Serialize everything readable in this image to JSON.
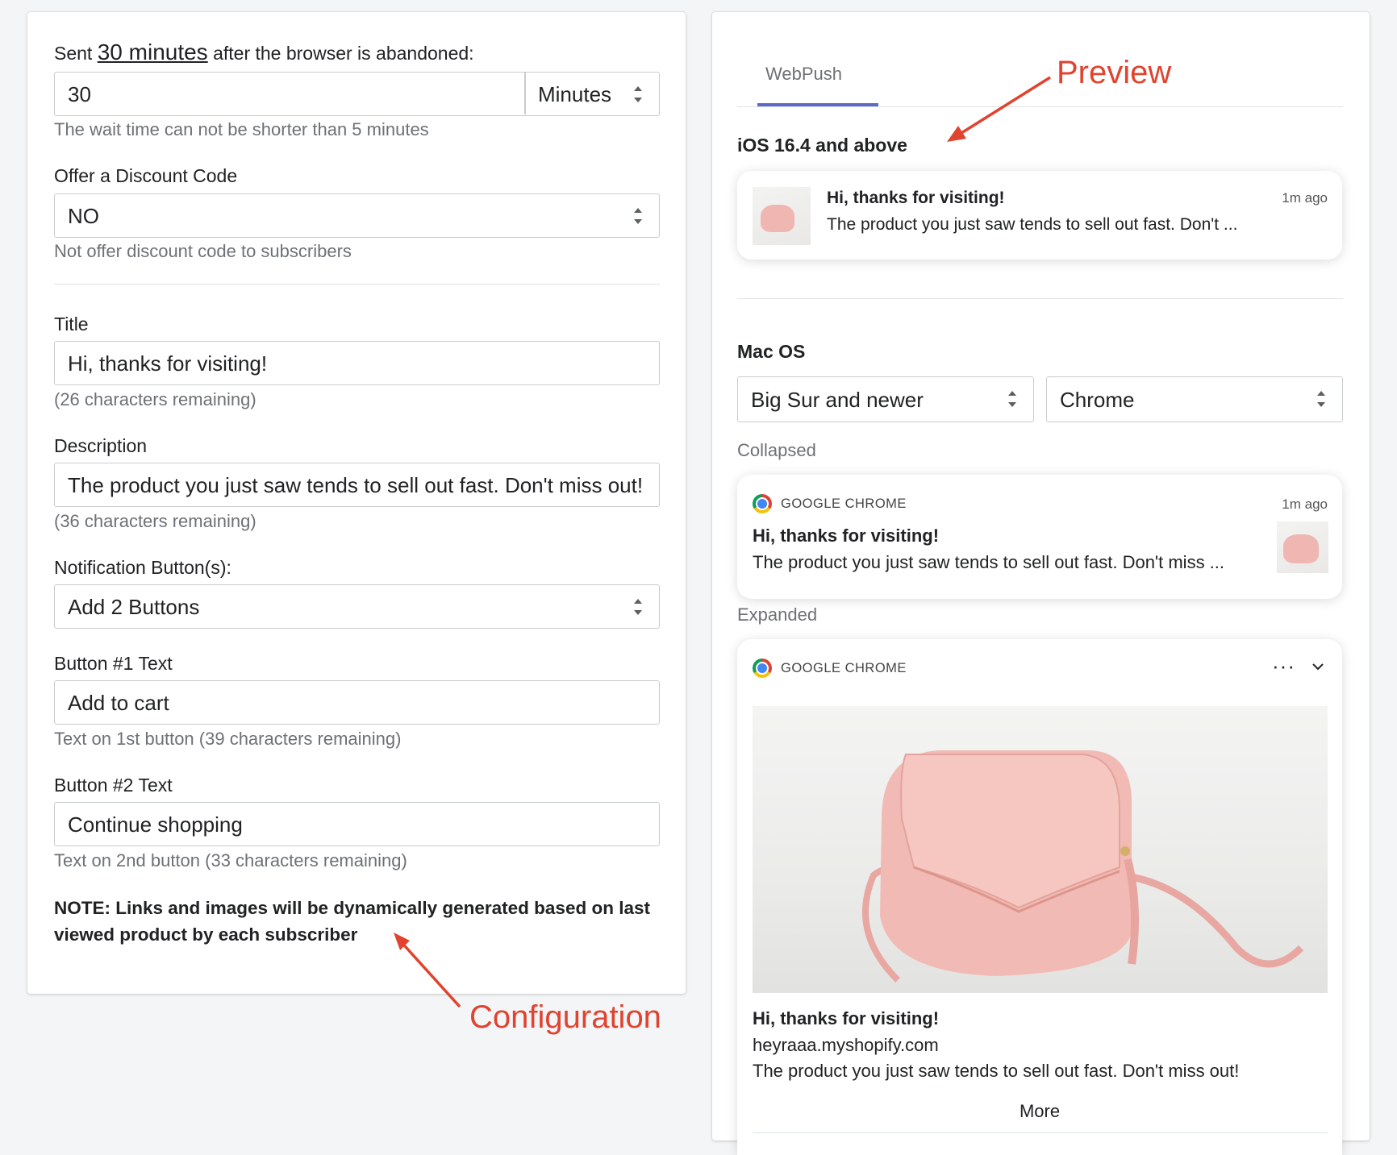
{
  "config": {
    "sent_prefix": "Sent",
    "sent_value": "30 minutes",
    "sent_suffix": "after the browser is abandoned:",
    "wait_value": "30",
    "wait_unit": "Minutes",
    "wait_hint": "The wait time can not be shorter than 5 minutes",
    "discount_label": "Offer a Discount Code",
    "discount_value": "NO",
    "discount_hint": "Not offer discount code to subscribers",
    "title_label": "Title",
    "title_value": "Hi, thanks for visiting!",
    "title_hint": "(26 characters remaining)",
    "desc_label": "Description",
    "desc_value": "The product you just saw tends to sell out fast. Don't miss out!",
    "desc_hint": "(36 characters remaining)",
    "buttons_label": "Notification Button(s):",
    "buttons_value": "Add 2 Buttons",
    "btn1_label": "Button #1 Text",
    "btn1_value": "Add to cart",
    "btn1_hint": "Text on 1st button (39 characters remaining)",
    "btn2_label": "Button #2 Text",
    "btn2_value": "Continue shopping",
    "btn2_hint": "Text on 2nd button (33 characters remaining)",
    "note": "NOTE: Links and images will be dynamically generated based on last viewed product by each subscriber"
  },
  "preview": {
    "tab": "WebPush",
    "ios_heading": "iOS 16.4 and above",
    "ios_title": "Hi, thanks for visiting!",
    "ios_time": "1m ago",
    "ios_body": "The product you just saw tends to sell out fast. Don't ...",
    "mac_heading": "Mac OS",
    "mac_version": "Big Sur and newer",
    "mac_browser": "Chrome",
    "collapsed_label": "Collapsed",
    "collapsed_app": "GOOGLE CHROME",
    "collapsed_time": "1m ago",
    "collapsed_title": "Hi, thanks for visiting!",
    "collapsed_body": "The product you just saw tends to sell out fast. Don't miss ...",
    "expanded_label": "Expanded",
    "expanded_app": "GOOGLE CHROME",
    "expanded_menu": "···",
    "expanded_title": "Hi, thanks for visiting!",
    "expanded_domain": "heyraaa.myshopify.com",
    "expanded_body": "The product you just saw tends to sell out fast. Don't miss out!",
    "expanded_more": "More"
  },
  "annotations": {
    "preview": "Preview",
    "configuration": "Configuration"
  },
  "colors": {
    "annotation": "#e0432f",
    "tab_indicator": "#5c6ac4",
    "bag": "#f0b7b2"
  }
}
